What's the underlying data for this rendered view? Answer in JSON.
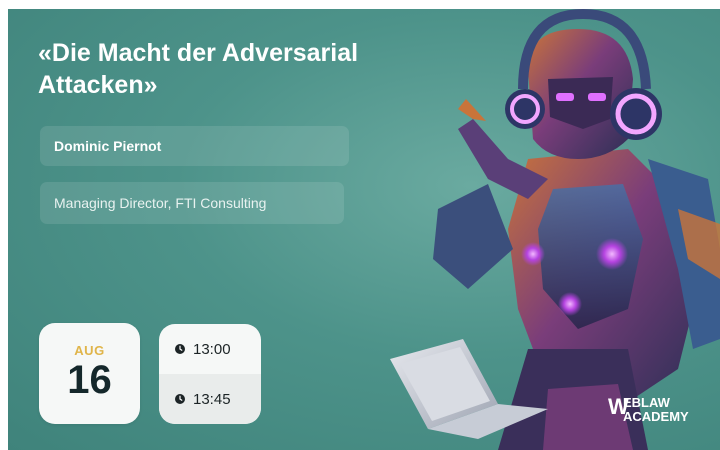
{
  "event": {
    "title_line1": "«Die Macht der Adversarial",
    "title_line2": "Attacken»",
    "speaker_name": "Dominic Piernot",
    "speaker_role": "Managing Director, FTI Consulting"
  },
  "date": {
    "month": "AUG",
    "day": "16"
  },
  "times": {
    "start": "13:00",
    "end": "13:45"
  },
  "brand": {
    "mark": "W",
    "line1": "EBLAW",
    "line2": "ACADEMY"
  },
  "icons": {
    "time_start": "clock-icon",
    "time_end": "clock-icon"
  },
  "colors": {
    "background": "#4d938a",
    "accent_month": "#e0b54a",
    "card_light": "#f6f8f7"
  }
}
